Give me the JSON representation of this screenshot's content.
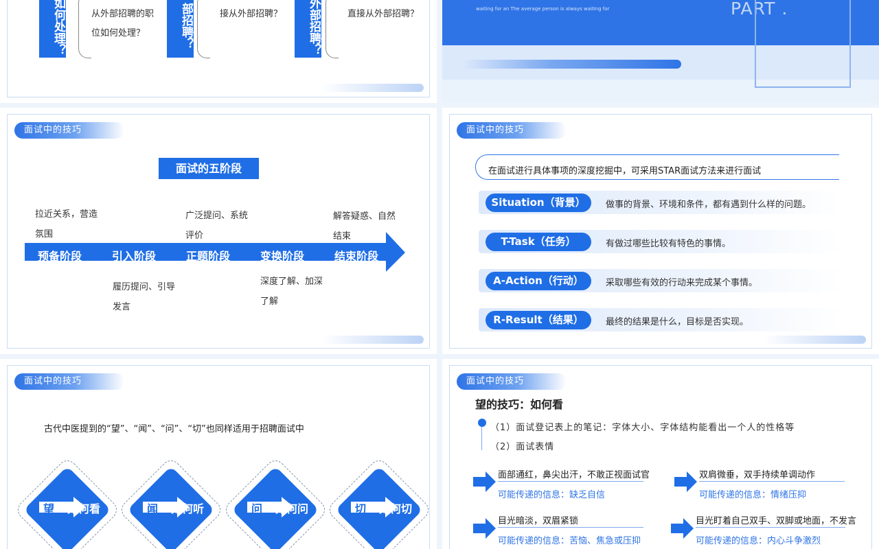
{
  "colors": {
    "accent": "#1f6ee6",
    "bg": "#eef4fb",
    "tag": "#2f74e6"
  },
  "slide1": {
    "col1": {
      "vertical": "如何处理？",
      "lines": [
        "从外部招聘的职",
        "位如何处理？"
      ]
    },
    "col2": {
      "vertical": "部招聘？",
      "lines": [
        "接从外部招聘？"
      ]
    },
    "col3": {
      "vertical": "外部招聘？",
      "lines": [
        "直接从外部招聘？"
      ]
    }
  },
  "slide2": {
    "subtitle": "waiting for an The average person is always waiting for",
    "part": "PART ."
  },
  "slide3": {
    "tag": "面试中的技巧",
    "title": "面试的五阶段",
    "stages": [
      "预备阶段",
      "引入阶段",
      "正题阶段",
      "变换阶段",
      "结束阶段"
    ],
    "notes_top": [
      {
        "l1": "拉近关系，营造",
        "l2": "氛围"
      },
      {
        "l1": "广泛提问、系统",
        "l2": "评价"
      },
      {
        "l1": "解答疑惑、自然",
        "l2": "结束"
      }
    ],
    "notes_bottom": [
      {
        "l1": "履历提问、引导",
        "l2": "发言"
      },
      {
        "l1": "深度了解、加深",
        "l2": "了解"
      }
    ]
  },
  "slide4": {
    "tag": "面试中的技巧",
    "intro": "在面试进行具体事项的深度挖掘中，可采用STAR面试方法来进行面试",
    "rows": [
      {
        "label": "Situation（背景）",
        "desc": "做事的背景、环境和条件，都有遇到什么样的问题。"
      },
      {
        "label": "T-Task（任务）",
        "desc": "有做过哪些比较有特色的事情。"
      },
      {
        "label": "A-Action（行动）",
        "desc": "采取哪些有效的行动来完成某个事情。"
      },
      {
        "label": "R-Result（结果）",
        "desc": "最终的结果是什么，目标是否实现。"
      }
    ]
  },
  "slide5": {
    "tag": "面试中的技巧",
    "intro": "古代中医提到的“望”、“闻”、“问”、“切”也同样适用于招聘面试中",
    "items": [
      {
        "char": "望",
        "label": "如何看"
      },
      {
        "char": "闻",
        "label": "如何听"
      },
      {
        "char": "问",
        "label": "如何问"
      },
      {
        "char": "切",
        "label": "如何切"
      }
    ]
  },
  "slide6": {
    "tag": "面试中的技巧",
    "title": "望的技巧：如何看",
    "points": [
      "（1）面试登记表上的笔记：字体大小、字体结构能看出一个人的性格等",
      "（2）面试表情"
    ],
    "signs": [
      {
        "text": "面部通红，鼻尖出汗，不敢正视面试官",
        "info": "可能传递的信息：缺乏自信"
      },
      {
        "text": "双肩微垂，双手持续单调动作",
        "info": "可能传递的信息：情绪压抑"
      },
      {
        "text": "目光暗淡，双眉紧锁",
        "info": "可能传递的信息：苦恼、焦急或压抑"
      },
      {
        "text": "目光盯着自己双手、双脚或地面，不发言",
        "info": "可能传递的信息：内心斗争激烈"
      }
    ]
  }
}
